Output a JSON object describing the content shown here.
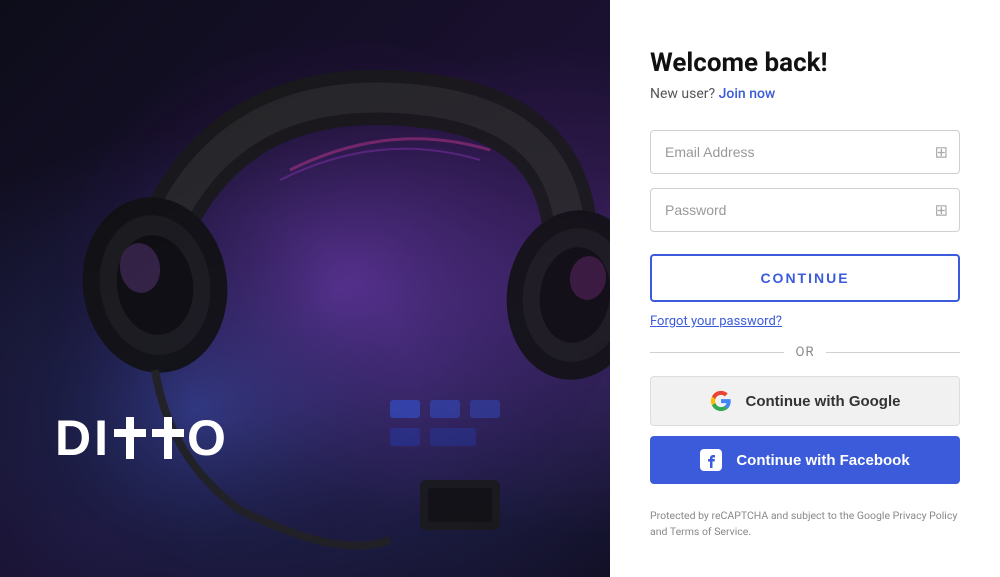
{
  "brand": {
    "logo_text": "DI++O",
    "logo_parts": [
      "DI",
      "+",
      "+",
      "O"
    ]
  },
  "background": {
    "alt": "Headphones on a colorful background"
  },
  "login_panel": {
    "title": "Welcome back!",
    "new_user_label": "New user?",
    "join_link": "Join now",
    "email_placeholder": "Email Address",
    "password_placeholder": "Password",
    "continue_button": "CONTINUE",
    "forgot_password": "Forgot your password?",
    "divider_text": "OR",
    "google_button": "Continue with Google",
    "facebook_button": "Continue with Facebook",
    "recaptcha_text": "Protected by reCAPTCHA and subject to the Google Privacy Policy and Terms of Service."
  },
  "colors": {
    "accent": "#3b5bdb",
    "facebook": "#3b5bdb",
    "text_primary": "#111111",
    "text_secondary": "#555555"
  }
}
